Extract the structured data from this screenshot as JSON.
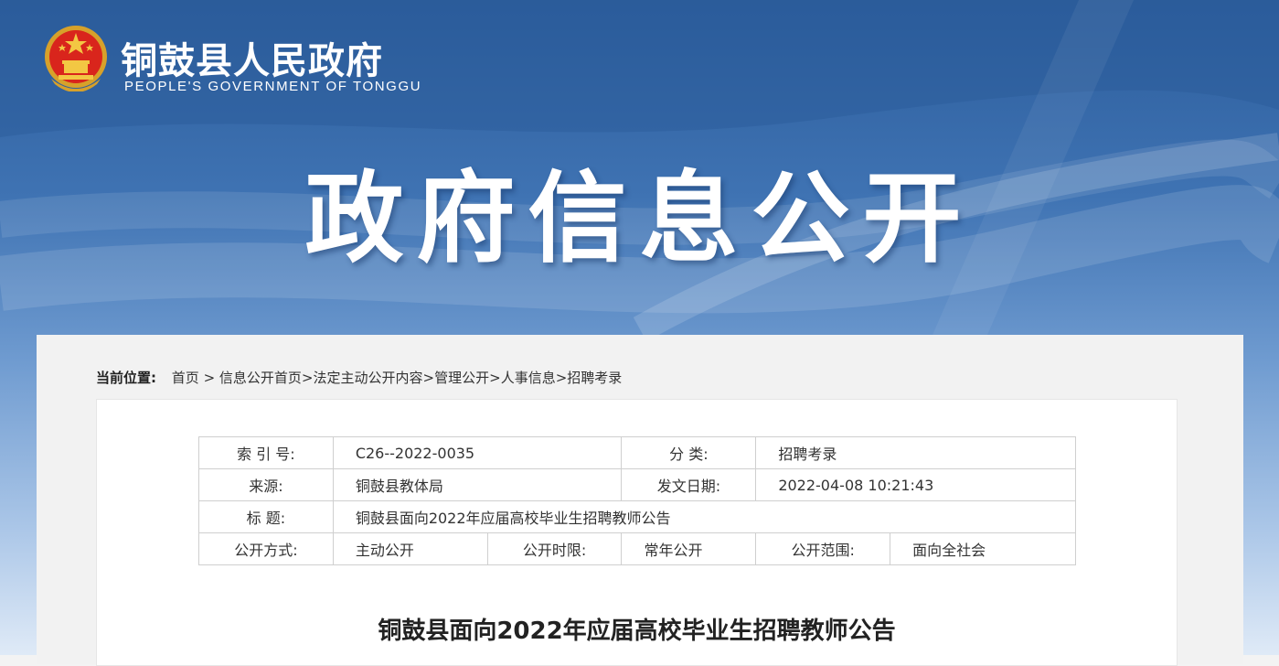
{
  "header": {
    "site_title": "铜鼓县人民政府",
    "site_subtitle": "PEOPLE'S GOVERNMENT OF TONGGU",
    "hero_title": "政府信息公开",
    "emblem_icon": "national-emblem-icon"
  },
  "breadcrumb": {
    "label": "当前位置:",
    "items": [
      "首页",
      "信息公开首页",
      "法定主动公开内容",
      "管理公开",
      "人事信息",
      "招聘考录"
    ],
    "first_sep": " > ",
    "sep": ">"
  },
  "meta": {
    "index_label": "索 引 号:",
    "index_value": "C26--2022-0035",
    "category_label": "分 类:",
    "category_value": "招聘考录",
    "source_label": "来源:",
    "source_value": "铜鼓县教体局",
    "date_label": "发文日期:",
    "date_value": "2022-04-08 10:21:43",
    "title_label": "标 题:",
    "title_value": "铜鼓县面向2022年应届高校毕业生招聘教师公告",
    "method_label": "公开方式:",
    "method_value": "主动公开",
    "period_label": "公开时限:",
    "period_value": "常年公开",
    "scope_label": "公开范围:",
    "scope_value": "面向全社会"
  },
  "document": {
    "title": "铜鼓县面向2022年应届高校毕业生招聘教师公告"
  },
  "colors": {
    "banner_top": "#2c5d9c",
    "banner_bottom": "#dfeaf7",
    "panel_bg": "#f2f2f2"
  }
}
